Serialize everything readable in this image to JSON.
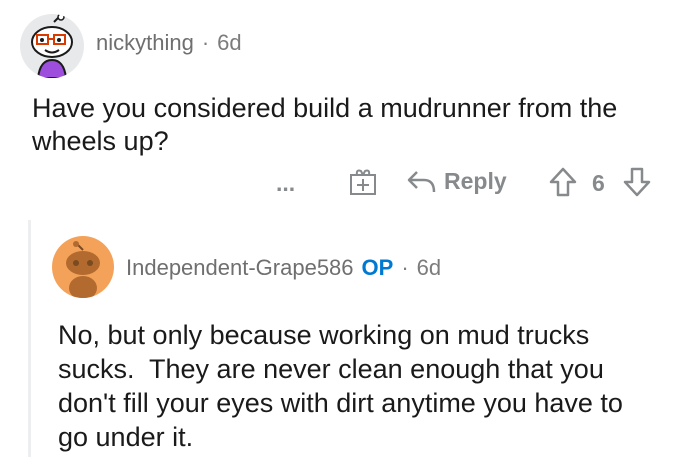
{
  "comments": [
    {
      "username": "nickything",
      "age": "6d",
      "text": "Have you considered build a mudrunner from the wheels up?",
      "actions": {
        "more": "...",
        "reply_label": "Reply",
        "score": "6"
      }
    },
    {
      "username": "Independent-Grape586",
      "op_badge": "OP",
      "age": "6d",
      "text_lines": [
        "No, but only because working on mud trucks",
        "sucks.  They are never clean enough that you",
        "don't fill your eyes with dirt anytime you have to",
        "go under it."
      ]
    }
  ],
  "colors": {
    "meta_gray": "#7c7c7c",
    "op_blue": "#0079d3",
    "avatar_bg_1": "#e8e9ea",
    "avatar_bg_2": "#f4a259"
  }
}
